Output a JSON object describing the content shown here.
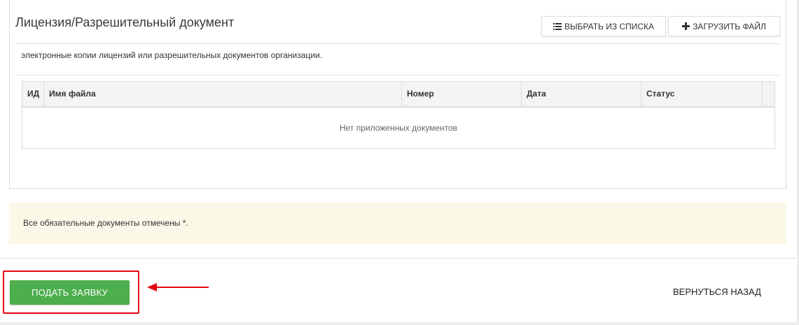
{
  "section": {
    "title": "Лицензия/Разрешительный документ",
    "description": "электронные копии лицензий или разрешительных документов организации."
  },
  "toolbar": {
    "select_from_list_label": "ВЫБРАТЬ ИЗ СПИСКА",
    "select_icon": "list-icon",
    "upload_file_label": "ЗАГРУЗИТЬ ФАЙЛ",
    "upload_icon": "plus-icon"
  },
  "table": {
    "columns": [
      "ИД",
      "Имя файла",
      "Номер",
      "Дата",
      "Статус"
    ],
    "empty_message": "Нет приложенных документов"
  },
  "notice": {
    "text": "Все обязательные документы отмечены *.",
    "background_color": "#fcf8e7"
  },
  "footer": {
    "submit_label": "ПОДАТЬ ЗАЯВКУ",
    "submit_color": "#4cae4c",
    "back_label": "ВЕРНУТЬСЯ НАЗАД",
    "highlight_color": "#e30613"
  }
}
